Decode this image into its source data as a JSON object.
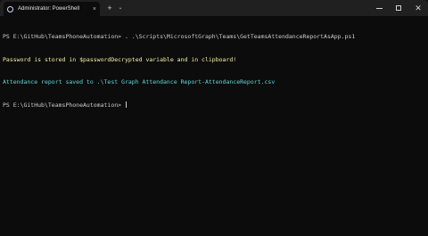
{
  "tab": {
    "title": "Administrator: PowerShell",
    "close_glyph": "×",
    "icon": "powershell-icon"
  },
  "toolbar": {
    "new_tab_glyph": "+",
    "dropdown_glyph": "⌄"
  },
  "window_controls": {
    "close_glyph": "✕"
  },
  "terminal": {
    "line1_prompt": "PS E:\\GitHub\\TeamsPhoneAutomation> ",
    "line1_dot": ". ",
    "line1_script": ".\\Scripts\\MicrosoftGraph\\Teams\\GetTeamsAttendanceReportAsApp.ps1",
    "line2": "Password is stored in $passwordDecrypted variable and in clipboard!",
    "line3": "Attendance report saved to .\\Test Graph Attendance Report-AttendanceReport.csv",
    "line4_prompt": "PS E:\\GitHub\\TeamsPhoneAutomation> "
  },
  "colors": {
    "background": "#0c0c0c",
    "titlebar": "#202020",
    "yellow": "#f9f1a5",
    "cyan": "#61d6d6",
    "text": "#cccccc"
  }
}
